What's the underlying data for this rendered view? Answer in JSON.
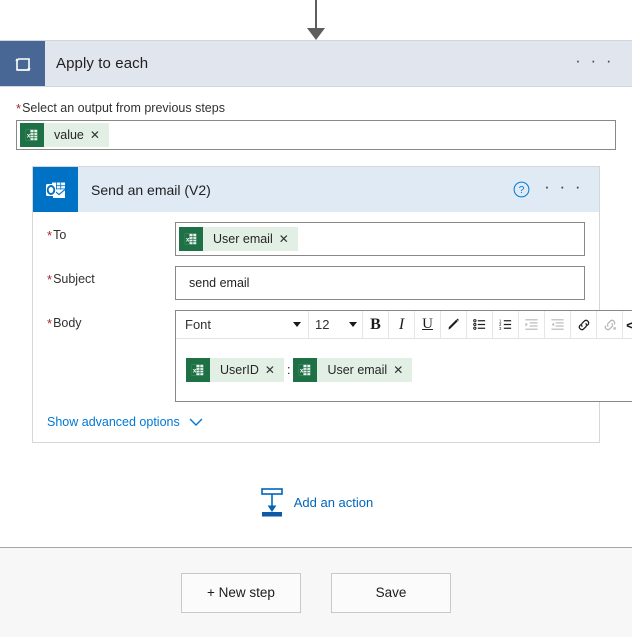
{
  "connector": {
    "icon": "down-arrow-icon"
  },
  "scope": {
    "icon": "loop-repeat-icon",
    "title": "Apply to each",
    "ellipsis": "· · ·",
    "output_field": {
      "label": "Select an output from previous steps",
      "required_marker": "*",
      "token": {
        "icon": "excel-icon",
        "text": "value",
        "remove": "✕"
      }
    }
  },
  "action_card": {
    "icon": "outlook-icon",
    "title": "Send an email (V2)",
    "help_icon": "help-circle-icon",
    "ellipsis": "· · ·",
    "fields": {
      "to": {
        "label": "To",
        "required_marker": "*",
        "token": {
          "icon": "excel-icon",
          "text": "User email",
          "remove": "✕"
        }
      },
      "subject": {
        "label": "Subject",
        "required_marker": "*",
        "value": "send email"
      },
      "body": {
        "label": "Body",
        "required_marker": "*",
        "toolbar": {
          "font_name": "Font",
          "font_size": "12",
          "bold": "B",
          "italic": "I",
          "underline": "U",
          "highlight_icon": "pen-highlight-icon",
          "bulleted_list_icon": "bulleted-list-icon",
          "numbered_list_icon": "numbered-list-icon",
          "indent_icon": "indent-increase-icon",
          "outdent_icon": "indent-decrease-icon",
          "link_icon": "link-icon",
          "unlink_icon": "unlink-icon",
          "code_label": "</>"
        },
        "tokens": [
          {
            "icon": "excel-icon",
            "text": "UserID",
            "remove": "✕"
          },
          {
            "icon": "excel-icon",
            "text": "User email",
            "remove": "✕"
          }
        ],
        "separator": ":"
      }
    },
    "advanced_options": {
      "label": "Show advanced options",
      "caret_icon": "chevron-down-icon"
    }
  },
  "add_action": {
    "icon": "add-action-arrow-icon",
    "label": "Add an action"
  },
  "bottom_bar": {
    "new_step_label": "+ New step",
    "save_label": "Save"
  },
  "colors": {
    "scope_header_bg": "#e1e5ee",
    "scope_icon_bg": "#486794",
    "card_header_bg": "#dfeaf5",
    "outlook_blue": "#0072c6",
    "excel_green": "#1e7145",
    "token_bg": "#e2efe4",
    "link_blue": "#0078d4",
    "required_red": "#a4262c"
  }
}
